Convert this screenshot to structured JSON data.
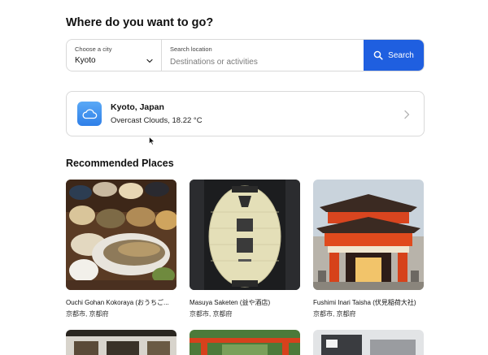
{
  "page": {
    "title": "Where do you want to go?"
  },
  "search": {
    "city_caption": "Choose a city",
    "city_value": "Kyoto",
    "location_caption": "Search location",
    "location_placeholder": "Destinations or activities",
    "location_value": "",
    "button_label": "Search"
  },
  "weather": {
    "city": "Kyoto, Japan",
    "description": "Overcast Clouds, 18.22 °C",
    "icon": "cloud-icon"
  },
  "recommended": {
    "title": "Recommended Places",
    "places": [
      {
        "name": "Ouchi Gohan Kokoraya (おうちご...",
        "location": "京都市, 京都府",
        "image": "food-photo"
      },
      {
        "name": "Masuya Saketen (益や酒店)",
        "location": "京都市, 京都府",
        "image": "lantern-photo"
      },
      {
        "name": "Fushimi Inari Taisha (伏見稲荷大社)",
        "location": "京都市, 京都府",
        "image": "shrine-gate-photo"
      }
    ]
  },
  "colors": {
    "primary": "#1f5fe0",
    "border": "#d9d9d9",
    "weather_icon": "#3a8bef"
  }
}
